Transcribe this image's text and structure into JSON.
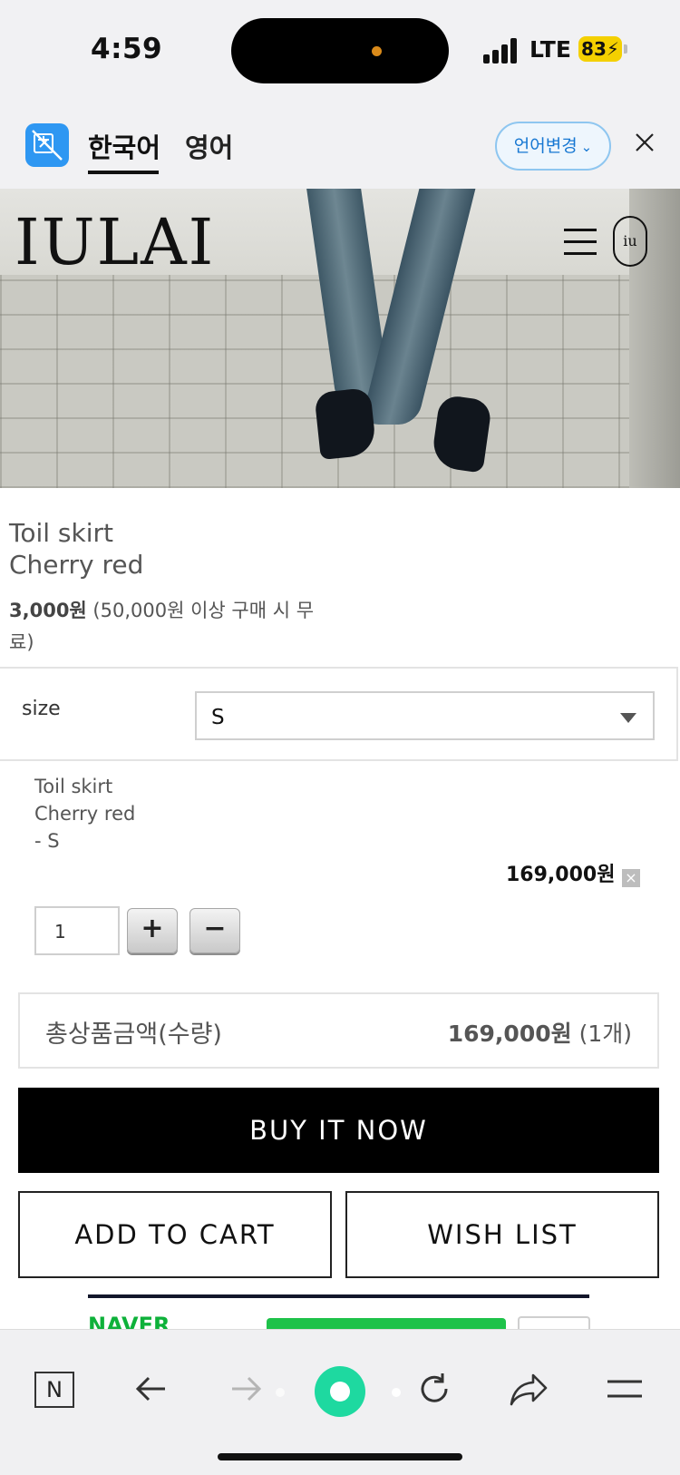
{
  "status_bar": {
    "time": "4:59",
    "network": "LTE",
    "battery": "83"
  },
  "translate_bar": {
    "tabs": [
      "한국어",
      "영어"
    ],
    "active_tab": "한국어",
    "change_language_label": "언어변경"
  },
  "site": {
    "logo": "IULAI",
    "badge_text": "iu"
  },
  "product": {
    "name_line1": "Toil skirt",
    "name_line2": "Cherry red",
    "shipping_fee": "3,000원",
    "shipping_note": " (50,000원 이상 구매 시 무료)"
  },
  "option": {
    "label": "size",
    "selected": "S"
  },
  "selected_item": {
    "name_line1": "Toil skirt",
    "name_line2": "Cherry red",
    "option_line": "- S",
    "price": "169,000원",
    "quantity": "1",
    "plus_label": "+",
    "minus_label": "−",
    "remove_label": "×"
  },
  "total": {
    "label": "총상품금액(수량)",
    "amount": "169,000원",
    "count": " (1개)"
  },
  "actions": {
    "buy_now": "BUY IT NOW",
    "add_to_cart": "ADD TO CART",
    "wish_list": "WISH LIST"
  },
  "naver_pay": {
    "text": "NAVER"
  },
  "browser_toolbar": {
    "n_label": "N",
    "icons": [
      "n-icon",
      "back-arrow-icon",
      "forward-arrow-icon",
      "green-dot-icon",
      "refresh-icon",
      "share-icon",
      "menu-icon"
    ]
  },
  "colors": {
    "lang_button_text": "#1677d2",
    "buy_button_bg": "#000000",
    "naver_green": "#1ec24a",
    "translate_icon": "#2e97f2",
    "battery": "#f4d000"
  }
}
